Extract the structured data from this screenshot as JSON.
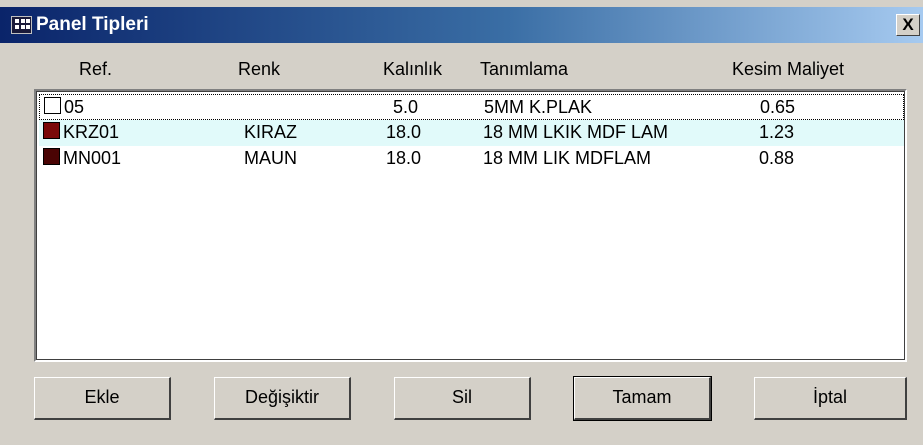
{
  "window": {
    "title": "Panel Tipleri",
    "close_label": "X",
    "icon": "app-window-icon"
  },
  "columns": [
    "Ref.",
    "Renk",
    "Kalınlık",
    "Tanımlama",
    "Kesim Maliyet"
  ],
  "rows": [
    {
      "ref": "05",
      "renk": "",
      "kalinlik": "5.0",
      "tanimlama": "5MM K.PLAK",
      "maliyet": "0.65",
      "swatch_color": "#ffffff"
    },
    {
      "ref": "KRZ01",
      "renk": "KIRAZ",
      "kalinlik": "18.0",
      "tanimlama": "18 MM LKIK MDF LAM",
      "maliyet": "1.23",
      "swatch_color": "#7a0a0a"
    },
    {
      "ref": "MN001",
      "renk": "MAUN",
      "kalinlik": "18.0",
      "tanimlama": "18 MM LIK MDFLAM",
      "maliyet": "0.88",
      "swatch_color": "#4a0404"
    }
  ],
  "buttons": {
    "add": "Ekle",
    "modify": "Değişiktir",
    "delete": "Sil",
    "ok": "Tamam",
    "cancel": "İptal"
  },
  "colors": {
    "titlebar_start": "#0a246a",
    "titlebar_end": "#a6caf0",
    "selected_row": "#e1fafa",
    "face": "#d4d0c8"
  }
}
